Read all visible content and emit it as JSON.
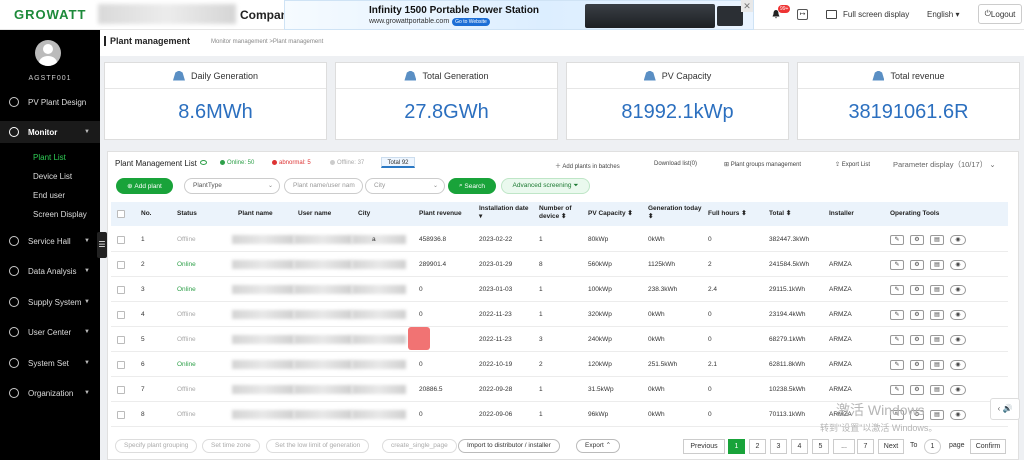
{
  "brand": {
    "logo": "GROWATT",
    "company": "Compan"
  },
  "ad": {
    "title": "Infinity 1500 Portable Power Station",
    "url": "www.growattportable.com",
    "button": "Go to Website",
    "close": "✕"
  },
  "topbar": {
    "badge": "99+",
    "fullscreen": "Full screen display",
    "language": "English",
    "logout": "Logout"
  },
  "sidebar": {
    "username": "AGSTF001",
    "items": [
      {
        "label": "PV Plant Design"
      },
      {
        "label": "Monitor"
      },
      {
        "label": "Service Hall"
      },
      {
        "label": "Data Analysis"
      },
      {
        "label": "Supply System"
      },
      {
        "label": "User Center"
      },
      {
        "label": "System Set"
      },
      {
        "label": "Organization"
      }
    ],
    "monitor_sub": [
      "Plant List",
      "Device List",
      "End user",
      "Screen Display"
    ]
  },
  "page": {
    "title": "Plant management",
    "breadcrumb": "Monitor management >Plant management"
  },
  "cards": [
    {
      "label": "Daily Generation",
      "value": "8.6MWh"
    },
    {
      "label": "Total Generation",
      "value": "27.8GWh"
    },
    {
      "label": "PV Capacity",
      "value": "81992.1kWp"
    },
    {
      "label": "Total revenue",
      "value": "38191061.6R"
    }
  ],
  "list": {
    "title": "Plant Management List",
    "online": "Online: 50",
    "abnormal": "abnormal: 5",
    "offline": "Offline: 37",
    "total": "Total 92",
    "add_batch": "Add plants in batches",
    "download": "Download list(0)",
    "groups": "Plant groups management",
    "export_list": "Export List",
    "param": "Parameter display（10/17）"
  },
  "filters": {
    "add_plant": "Add plant",
    "plant_type": "PlantType",
    "name_placeholder": "Plant name/user nam",
    "city_placeholder": "City",
    "search": "Search",
    "advanced": "Advanced screening"
  },
  "table": {
    "headers": [
      "No.",
      "Status",
      "Plant name",
      "User name",
      "City",
      "Plant revenue",
      "Installation date",
      "Number of device",
      "PV Capacity",
      "Generation today",
      "Full hours",
      "Total",
      "Installer",
      "Operating Tools"
    ],
    "rows": [
      {
        "no": "1",
        "status": "Offline",
        "city": "a",
        "revenue": "458936.8",
        "date": "2023-02-22",
        "devices": "1",
        "capacity": "80kWp",
        "today": "0kWh",
        "hours": "0",
        "total": "382447.3kWh",
        "installer": ""
      },
      {
        "no": "2",
        "status": "Online",
        "city": "",
        "revenue": "289901.4",
        "date": "2023-01-29",
        "devices": "8",
        "capacity": "560kWp",
        "today": "1125kWh",
        "hours": "2",
        "total": "241584.5kWh",
        "installer": "ARMZA"
      },
      {
        "no": "3",
        "status": "Online",
        "city": "",
        "revenue": "0",
        "date": "2023-01-03",
        "devices": "1",
        "capacity": "100kWp",
        "today": "238.3kWh",
        "hours": "2.4",
        "total": "29115.1kWh",
        "installer": "ARMZA"
      },
      {
        "no": "4",
        "status": "Offline",
        "city": "",
        "revenue": "0",
        "date": "2022-11-23",
        "devices": "1",
        "capacity": "320kWp",
        "today": "0kWh",
        "hours": "0",
        "total": "23194.4kWh",
        "installer": "ARMZA"
      },
      {
        "no": "5",
        "status": "Offline",
        "city": "",
        "revenue": "",
        "date": "2022-11-23",
        "devices": "3",
        "capacity": "240kWp",
        "today": "0kWh",
        "hours": "0",
        "total": "68279.1kWh",
        "installer": "ARMZA"
      },
      {
        "no": "6",
        "status": "Online",
        "city": "",
        "revenue": "0",
        "date": "2022-10-19",
        "devices": "2",
        "capacity": "120kWp",
        "today": "251.5kWh",
        "hours": "2.1",
        "total": "62811.8kWh",
        "installer": "ARMZA"
      },
      {
        "no": "7",
        "status": "Offline",
        "city": "",
        "revenue": "20886.5",
        "date": "2022-09-28",
        "devices": "1",
        "capacity": "31.5kWp",
        "today": "0kWh",
        "hours": "0",
        "total": "10238.5kWh",
        "installer": "ARMZA"
      },
      {
        "no": "8",
        "status": "Offline",
        "city": "",
        "revenue": "0",
        "date": "2022-09-06",
        "devices": "1",
        "capacity": "96kWp",
        "today": "0kWh",
        "hours": "0",
        "total": "70113.1kWh",
        "installer": "ARMZA"
      }
    ]
  },
  "bottom": {
    "buttons": [
      "Specify plant grouping",
      "Set time zone",
      "Set the low limit of generation",
      "create_single_page",
      "Import to distributor / installer",
      "Export"
    ],
    "previous": "Previous",
    "pages": [
      "1",
      "2",
      "3",
      "4",
      "5",
      "...",
      "7"
    ],
    "next": "Next",
    "to": "To",
    "page_input": "1",
    "page_label": "page",
    "confirm": "Confirm"
  },
  "watermark": {
    "line1": "激活 Windows",
    "line2": "转到\"设置\"以激活 Windows。"
  },
  "colors": {
    "green": "#19a33a",
    "blue_value": "#2b6fbf",
    "sidebar": "#000000"
  }
}
